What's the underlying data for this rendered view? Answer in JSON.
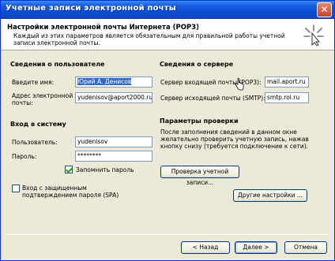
{
  "window": {
    "title": "Учетные записи электронной почты",
    "close_glyph": "✕"
  },
  "header": {
    "title": "Настройки электронной почты Интернета (POP3)",
    "description": "Каждый из этих параметров является обязательным для правильной работы учетной записи электронной почты."
  },
  "user_info": {
    "section_title": "Сведения о пользователе",
    "name_label": "Введите имя:",
    "name_value": "Юрий А. Денисов",
    "email_label": "Адрес электронной почты:",
    "email_value": "yudenisov@aport2000.ru"
  },
  "login": {
    "section_title": "Вход в систему",
    "user_label": "Пользователь:",
    "user_value": "yudenisov",
    "password_label": "Пароль:",
    "password_value": "********",
    "remember_label": "Запомнить пароль",
    "remember_checked": true,
    "spa_label": "Вход с защищенным подтверждением пароля (SPA)",
    "spa_checked": false
  },
  "server_info": {
    "section_title": "Сведения о сервере",
    "incoming_label": "Сервер входящей почты (POP3):",
    "incoming_value": "mail.aport.ru",
    "outgoing_label": "Сервер исходящей почты (SMTP):",
    "outgoing_value": "smtp.rol.ru"
  },
  "test": {
    "section_title": "Параметры проверки",
    "description": "После заполнения сведений в данном окне желательно проверить учетную запись, нажав кнопку снизу (требуется подключение к сети).",
    "test_button": "Проверка учетной записи...",
    "more_button": "Другие настройки ..."
  },
  "footer": {
    "back_button": "< Назад",
    "next_button": "Далее >",
    "cancel_button": "Отмена"
  }
}
